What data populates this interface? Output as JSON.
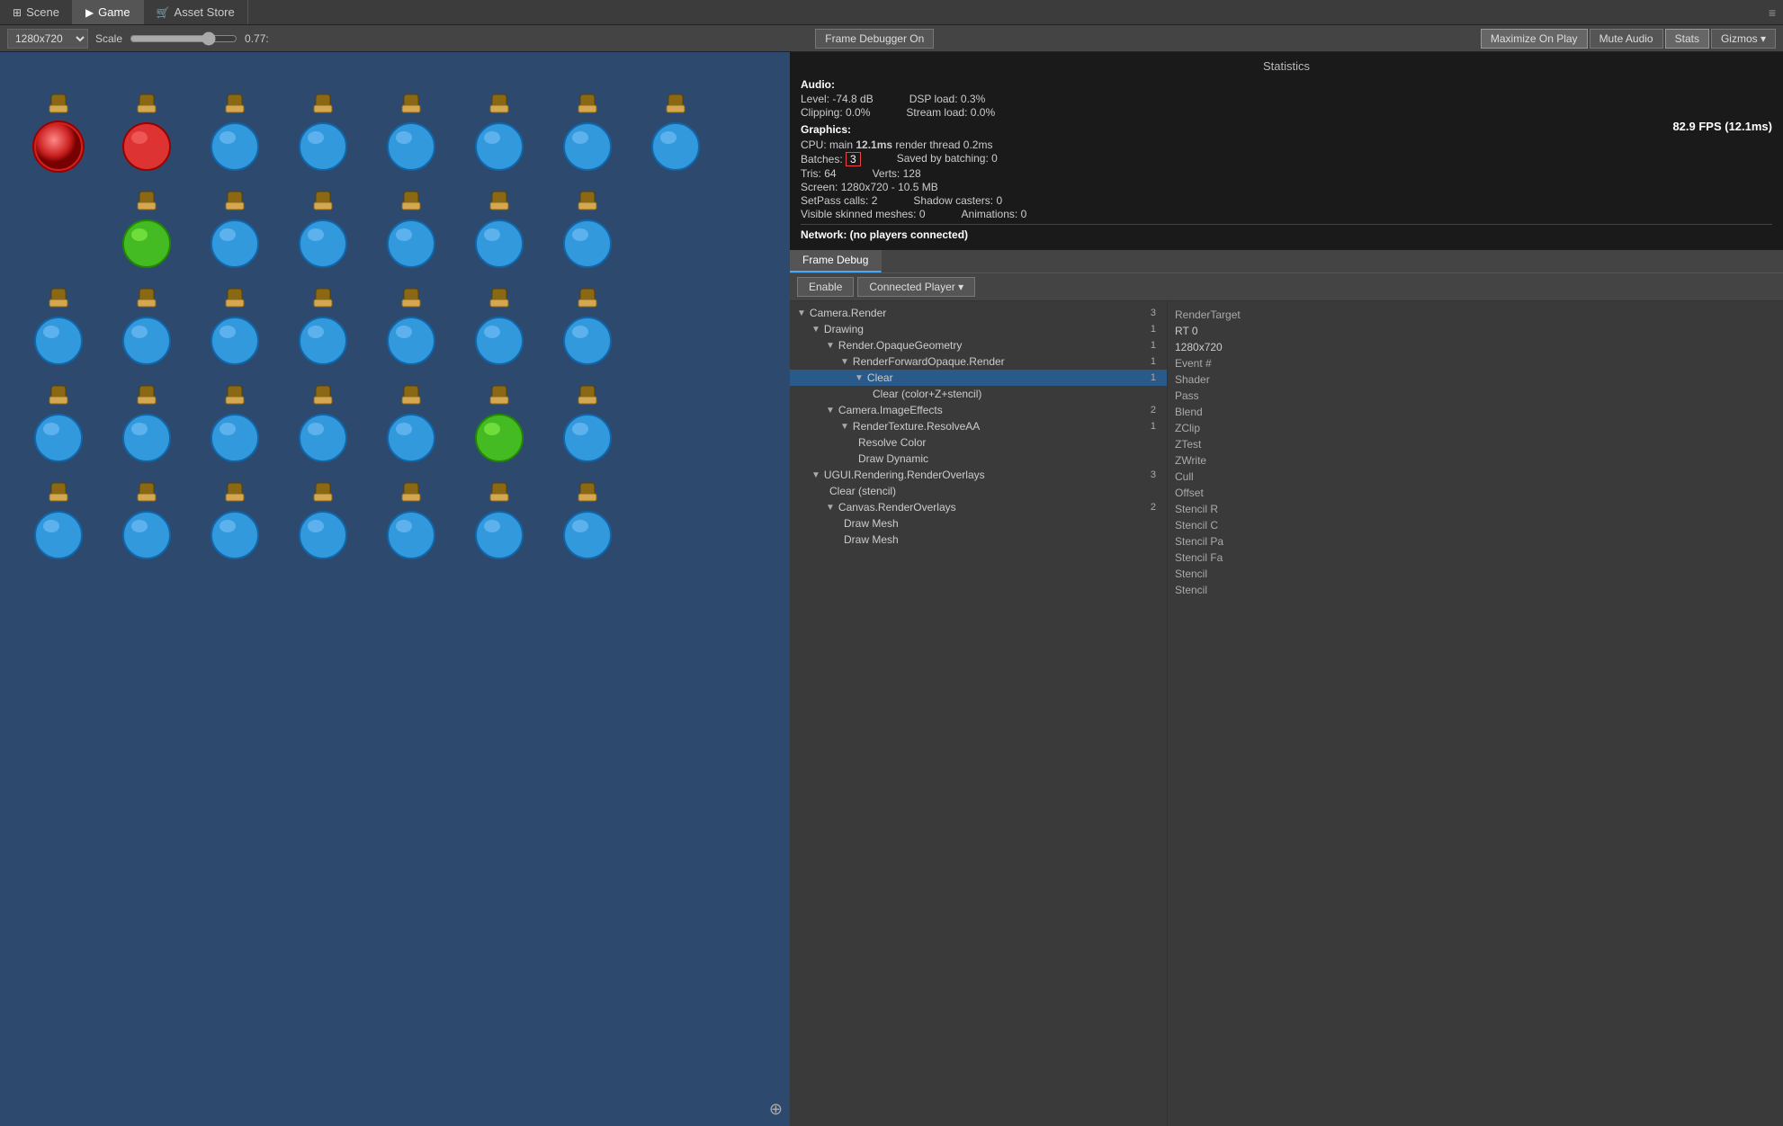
{
  "tabs": [
    {
      "id": "scene",
      "label": "Scene",
      "icon": "⊞",
      "active": false
    },
    {
      "id": "game",
      "label": "Game",
      "icon": "▶",
      "active": true
    },
    {
      "id": "asset-store",
      "label": "Asset Store",
      "icon": "🛒",
      "active": false
    }
  ],
  "toolbar": {
    "resolution": "1280x720",
    "scale_label": "Scale",
    "scale_value": "0.77:",
    "frame_debugger": "Frame Debugger On",
    "maximize_on_play": "Maximize On Play",
    "mute_audio": "Mute Audio",
    "stats": "Stats",
    "gizmos": "Gizmos ▾"
  },
  "statistics": {
    "title": "Statistics",
    "audio": {
      "label": "Audio:",
      "level_label": "Level:",
      "level_value": "-74.8 dB",
      "dsp_label": "DSP load:",
      "dsp_value": "0.3%",
      "clipping_label": "Clipping:",
      "clipping_value": "0.0%",
      "stream_label": "Stream load:",
      "stream_value": "0.0%"
    },
    "graphics": {
      "label": "Graphics:",
      "fps": "82.9 FPS (12.1ms)",
      "cpu_label": "CPU: main",
      "cpu_value": "12.1ms",
      "render_thread_label": "render thread",
      "render_thread_value": "0.2ms",
      "batches_label": "Batches:",
      "batches_value": "3",
      "saved_batching_label": "Saved by batching:",
      "saved_batching_value": "0",
      "tris_label": "Tris:",
      "tris_value": "64",
      "verts_label": "Verts:",
      "verts_value": "128",
      "screen_label": "Screen:",
      "screen_value": "1280x720 - 10.5 MB",
      "setpass_label": "SetPass calls:",
      "setpass_value": "2",
      "shadow_label": "Shadow casters:",
      "shadow_value": "0",
      "visible_skinned_label": "Visible skinned meshes:",
      "visible_skinned_value": "0",
      "animations_label": "Animations:",
      "animations_value": "0"
    },
    "network": {
      "label": "Network: (no players connected)"
    }
  },
  "frame_debug": {
    "tab_label": "Frame Debug",
    "enable_btn": "Enable",
    "connected_player_btn": "Connected Player ▾",
    "tree": [
      {
        "label": "Camera.Render",
        "indent": 0,
        "arrow": "▼",
        "count": "3",
        "selected": false
      },
      {
        "label": "Drawing",
        "indent": 1,
        "arrow": "▼",
        "count": "1",
        "selected": false
      },
      {
        "label": "Render.OpaqueGeometry",
        "indent": 2,
        "arrow": "▼",
        "count": "1",
        "selected": false
      },
      {
        "label": "RenderForwardOpaque.Render",
        "indent": 3,
        "arrow": "▼",
        "count": "1",
        "selected": false
      },
      {
        "label": "Clear",
        "indent": 4,
        "arrow": "▼",
        "count": "1",
        "selected": true
      },
      {
        "label": "Clear (color+Z+stencil)",
        "indent": 5,
        "arrow": "",
        "count": "",
        "selected": false
      },
      {
        "label": "Camera.ImageEffects",
        "indent": 2,
        "arrow": "▼",
        "count": "2",
        "selected": false
      },
      {
        "label": "RenderTexture.ResolveAA",
        "indent": 3,
        "arrow": "▼",
        "count": "1",
        "selected": false
      },
      {
        "label": "Resolve Color",
        "indent": 4,
        "arrow": "",
        "count": "",
        "selected": false
      },
      {
        "label": "Draw Dynamic",
        "indent": 4,
        "arrow": "",
        "count": "",
        "selected": false
      },
      {
        "label": "UGUI.Rendering.RenderOverlays",
        "indent": 1,
        "arrow": "▼",
        "count": "3",
        "selected": false
      },
      {
        "label": "Clear (stencil)",
        "indent": 2,
        "arrow": "",
        "count": "",
        "selected": false
      },
      {
        "label": "Canvas.RenderOverlays",
        "indent": 2,
        "arrow": "▼",
        "count": "2",
        "selected": false
      },
      {
        "label": "Draw Mesh",
        "indent": 3,
        "arrow": "",
        "count": "",
        "selected": false
      },
      {
        "label": "Draw Mesh",
        "indent": 3,
        "arrow": "",
        "count": "",
        "selected": false
      }
    ],
    "right_panel": {
      "render_target_label": "RenderTarget",
      "rt_label": "RT 0",
      "resolution_label": "1280x720",
      "event_label": "Event #",
      "shader_label": "Shader",
      "pass_label": "Pass",
      "blend_label": "Blend",
      "zclip_label": "ZClip",
      "ztest_label": "ZTest",
      "zwrite_label": "ZWrite",
      "cull_label": "Cull",
      "offset_label": "Offset",
      "stencil_ref_label": "Stencil R",
      "stencil_read_label": "Stencil C",
      "stencil_pass_label": "Stencil Pa",
      "stencil_fail_label": "Stencil Fa",
      "stencil1_label": "Stencil",
      "stencil2_label": "Stencil"
    }
  },
  "viewport": {
    "bg_color": "#2d4a6e"
  }
}
